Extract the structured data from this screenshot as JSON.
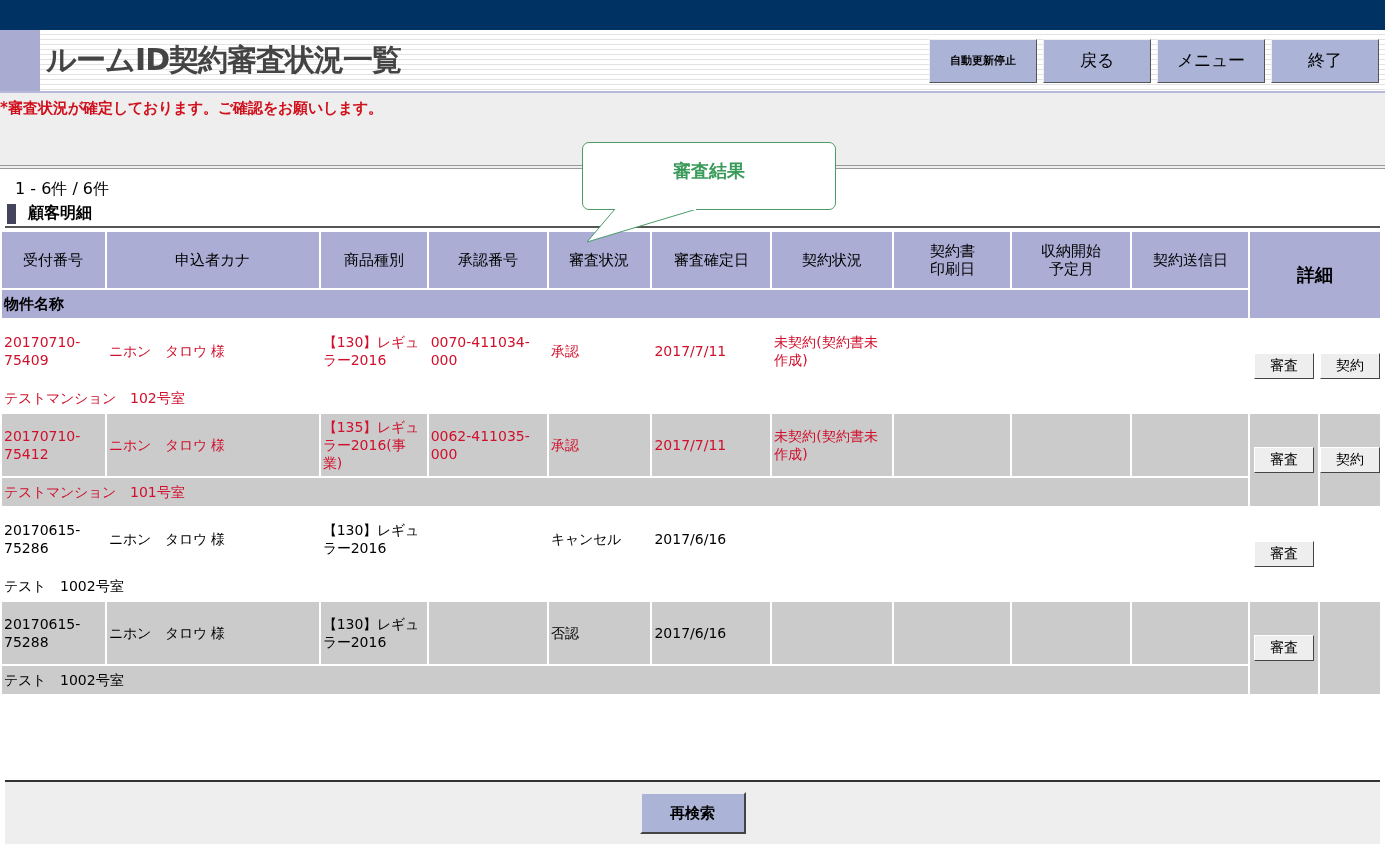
{
  "header": {
    "title": "ルームID契約審査状況一覧",
    "buttons": [
      "自動更新停止",
      "戻る",
      "メニュー",
      "終了"
    ]
  },
  "notice": "*審査状況が確定しております。ご確認をお願いします。",
  "callout": "審査結果",
  "count": "1 - 6件 / 6件",
  "section_title": "顧客明細",
  "table": {
    "columns": [
      "受付番号",
      "申込者カナ",
      "商品種別",
      "承認番号",
      "審査状況",
      "審査確定日",
      "契約状況",
      "契約書印刷日",
      "収納開始予定月",
      "契約送信日"
    ],
    "detail_column": "詳細",
    "sub_column": "物件名称",
    "rows": [
      {
        "highlighted": true,
        "cells": [
          "20170710-75409",
          "ニホン　タロウ 様",
          "【130】レギュラー2016",
          "0070-411034-000",
          "承認",
          "2017/7/11",
          "未契約(契約書未作成)",
          "",
          "",
          ""
        ],
        "property": "テストマンション　102号室",
        "buttons": [
          "審査",
          "契約"
        ]
      },
      {
        "highlighted": true,
        "cells": [
          "20170710-75412",
          "ニホン　タロウ 様",
          "【135】レギュラー2016(事業)",
          "0062-411035-000",
          "承認",
          "2017/7/11",
          "未契約(契約書未作成)",
          "",
          "",
          ""
        ],
        "property": "テストマンション　101号室",
        "buttons": [
          "審査",
          "契約"
        ]
      },
      {
        "highlighted": false,
        "cells": [
          "20170615-75286",
          "ニホン　タロウ 様",
          "【130】レギュラー2016",
          "",
          "キャンセル",
          "2017/6/16",
          "",
          "",
          "",
          ""
        ],
        "property": "テスト　1002号室",
        "buttons": [
          "審査"
        ]
      },
      {
        "highlighted": false,
        "cells": [
          "20170615-75288",
          "ニホン　タロウ 様",
          "【130】レギュラー2016",
          "",
          "否認",
          "2017/6/16",
          "",
          "",
          "",
          ""
        ],
        "property": "テスト　1002号室",
        "buttons": [
          "審査"
        ]
      }
    ]
  },
  "footer": {
    "button": "再検索"
  }
}
